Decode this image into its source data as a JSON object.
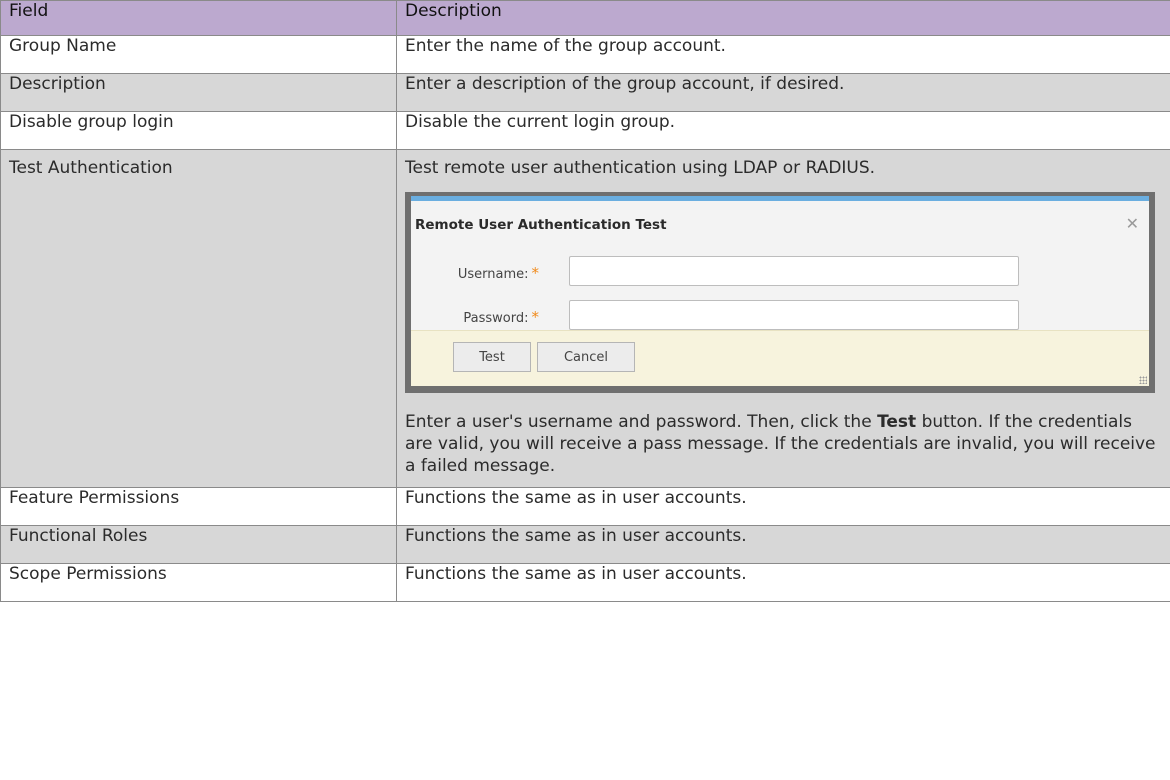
{
  "table": {
    "headers": [
      "Field",
      "Description"
    ],
    "rows": [
      {
        "field": "Group Name",
        "description": "Enter the name of the group account."
      },
      {
        "field": "Description",
        "description": "Enter a description of the group account, if desired."
      },
      {
        "field": "Disable group login",
        "description": "Disable the current login group."
      },
      {
        "field": "Test Authentication",
        "description": "Test remote user authentication using LDAP or RADIUS."
      },
      {
        "field": "Feature Permissions",
        "description": "Functions the same as in user accounts."
      },
      {
        "field": "Functional Roles",
        "description": "Functions the same as in user accounts."
      },
      {
        "field": "Scope Permissions",
        "description": "Functions the same as in user accounts."
      }
    ],
    "test_auth_note": {
      "before": "Enter a user's username and password. Then, click the ",
      "bold": "Test",
      "after": " button. If the credentials are valid, you will receive a pass message. If the credentials are invalid, you will receive a failed message."
    }
  },
  "dialog": {
    "title": "Remote User Authentication Test",
    "close_icon": "close-icon",
    "fields": [
      {
        "label": "Username:",
        "required": "*",
        "value": ""
      },
      {
        "label": "Password:",
        "required": "*",
        "value": ""
      }
    ],
    "buttons": {
      "test": "Test",
      "cancel": "Cancel"
    }
  },
  "colors": {
    "header_bg": "#bca9cf",
    "shaded_row_bg": "#d7d7d7",
    "dialog_accent": "#6aaee0",
    "required_star": "#f08a1c",
    "dialog_footer_bg": "#f7f3dd"
  }
}
